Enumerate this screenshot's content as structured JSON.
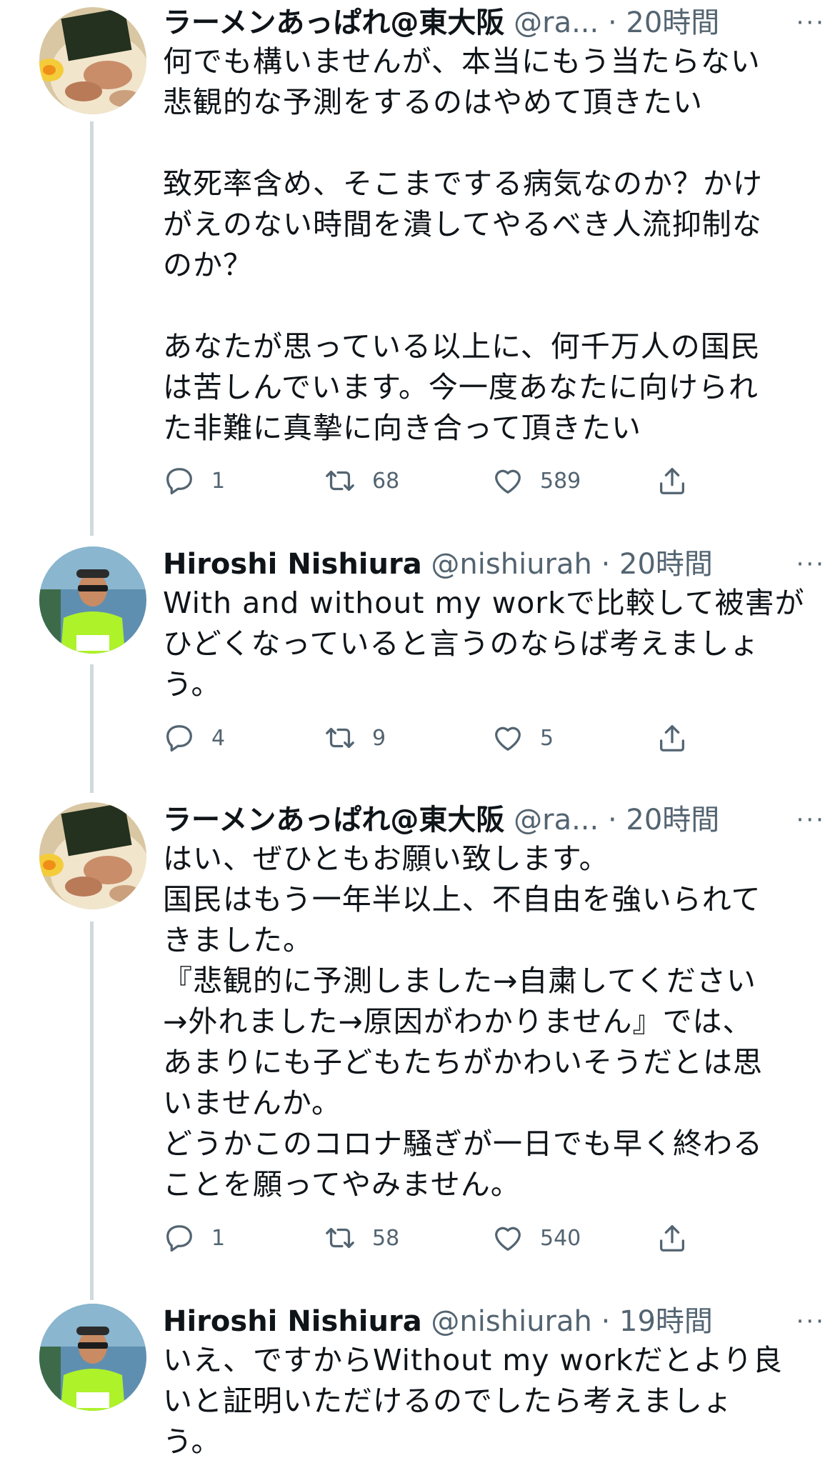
{
  "tweets": [
    {
      "author": "ラーメンあっぱれ@東大阪",
      "handle": "@ra...",
      "time": "20時間",
      "more": "···",
      "lines": [
        "何でも構いませんが、本当にもう当たらない",
        "悲観的な予測をするのはやめて頂きたい",
        "",
        "致死率含め、そこまでする病気なのか？かけ",
        "がえのない時間を潰してやるべき人流抑制な",
        "のか？",
        "",
        "あなたが思っている以上に、何千万人の国民",
        "は苦しんでいます。今一度あなたに向けられ",
        "た非難に真摯に向き合って頂きたい"
      ],
      "stats": {
        "replies": "1",
        "retweets": "68",
        "likes": "589"
      }
    },
    {
      "author": "Hiroshi Nishiura",
      "handle": "@nishiurah",
      "time": "20時間",
      "more": "···",
      "lines": [
        "With and without my workで比較して被害が",
        "ひどくなっていると言うのならば考えましょ",
        "う。"
      ],
      "stats": {
        "replies": "4",
        "retweets": "9",
        "likes": "5"
      }
    },
    {
      "author": "ラーメンあっぱれ@東大阪",
      "handle": "@ra...",
      "time": "20時間",
      "more": "···",
      "lines": [
        "はい、ぜひともお願い致します。",
        "国民はもう一年半以上、不自由を強いられて",
        "きました。",
        "『悲観的に予測しました→自粛してください",
        "→外れました→原因がわかりません』では、",
        "あまりにも子どもたちがかわいそうだとは思",
        "いませんか。",
        "どうかこのコロナ騒ぎが一日でも早く終わる",
        "ことを願ってやみません。"
      ],
      "stats": {
        "replies": "1",
        "retweets": "58",
        "likes": "540"
      }
    },
    {
      "author": "Hiroshi Nishiura",
      "handle": "@nishiurah",
      "time": "19時間",
      "more": "···",
      "lines": [
        "いえ、ですからWithout my workだとより良",
        "いと証明いただけるのでしたら考えましょ",
        "う。"
      ]
    }
  ],
  "separator": "·",
  "colors": {
    "text": "#0f1419",
    "secondary": "#536471",
    "thread_line": "#cfd9de"
  },
  "icons": {
    "reply": "reply-icon",
    "retweet": "retweet-icon",
    "like": "heart-icon",
    "share": "share-icon",
    "more": "more-icon"
  }
}
